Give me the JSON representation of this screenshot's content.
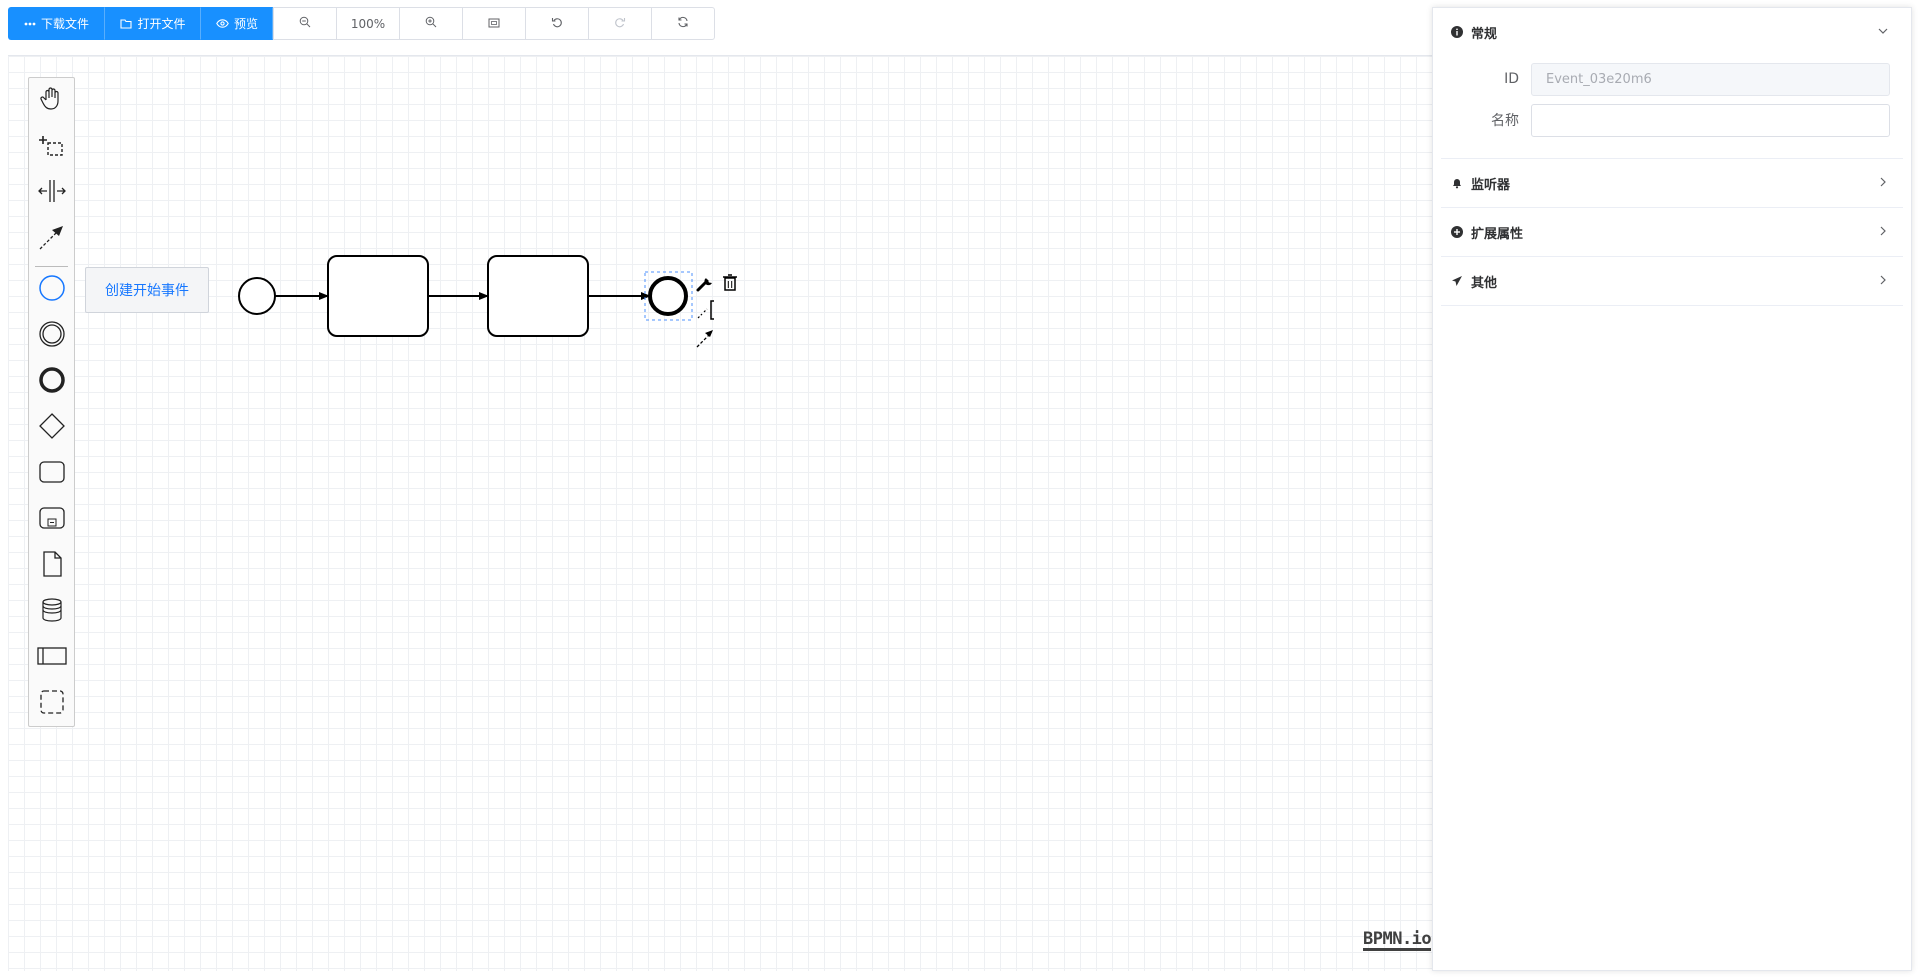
{
  "toolbar": {
    "download_label": "下载文件",
    "open_label": "打开文件",
    "preview_label": "预览",
    "zoom_level": "100%"
  },
  "palette": {
    "tooltip": "创建开始事件",
    "tools": [
      "hand-tool",
      "lasso-tool",
      "space-tool",
      "global-connect-tool",
      "start-event",
      "intermediate-event",
      "end-event",
      "gateway",
      "task",
      "subprocess",
      "data-object",
      "data-store",
      "pool",
      "group"
    ]
  },
  "panel": {
    "general": {
      "title": "常规",
      "id_label": "ID",
      "id_value": "Event_03e20m6",
      "name_label": "名称",
      "name_value": ""
    },
    "listeners": {
      "title": "监听器"
    },
    "extensions": {
      "title": "扩展属性"
    },
    "other": {
      "title": "其他"
    }
  },
  "watermark": "BPMN.io",
  "colors": {
    "primary": "#1890ff",
    "tooltip_text": "#1677ff",
    "selection": "#4d90fe"
  }
}
